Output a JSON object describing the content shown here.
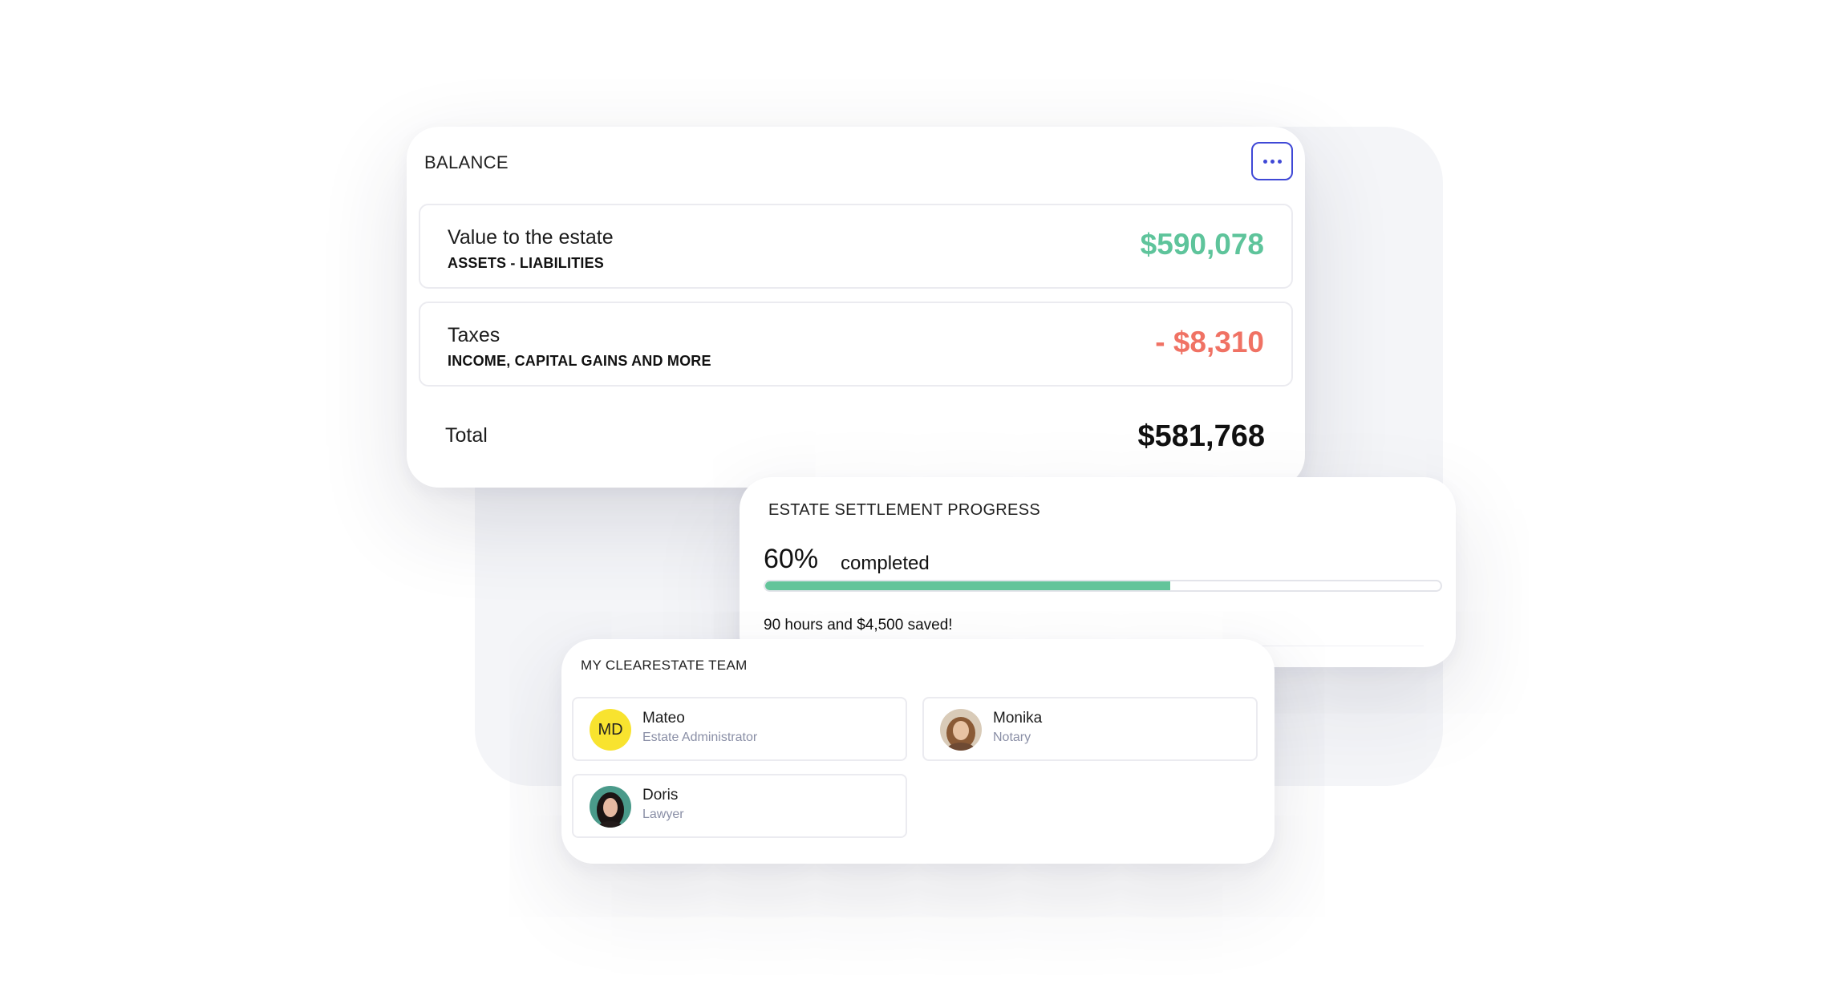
{
  "balance": {
    "title": "BALANCE",
    "more_icon": "more-horizontal-icon",
    "rows": [
      {
        "label": "Value to the estate",
        "sub": "ASSETS - LIABILITIES",
        "amount": "$590,078",
        "color": "#5ec49b"
      },
      {
        "label": "Taxes",
        "sub": "INCOME, CAPITAL GAINS AND MORE",
        "amount": "- $8,310",
        "color": "#f07264"
      }
    ],
    "total": {
      "label": "Total",
      "amount": "$581,768"
    }
  },
  "progress": {
    "title": "ESTATE SETTLEMENT PROGRESS",
    "percent_label": "60%",
    "completed_label": "completed",
    "percent_value": 60,
    "saved_text": "90 hours and $4,500 saved!",
    "bar_color": "#63c49a"
  },
  "team": {
    "title": "MY CLEARESTATE TEAM",
    "members": [
      {
        "name": "Mateo",
        "role": "Estate Administrator",
        "initials": "MD"
      },
      {
        "name": "Monika",
        "role": "Notary"
      },
      {
        "name": "Doris",
        "role": "Lawyer"
      }
    ]
  },
  "colors": {
    "accent": "#3f48d6",
    "positive": "#5ec49b",
    "negative": "#f07264",
    "avatar_initials_bg": "#f8e32f"
  }
}
